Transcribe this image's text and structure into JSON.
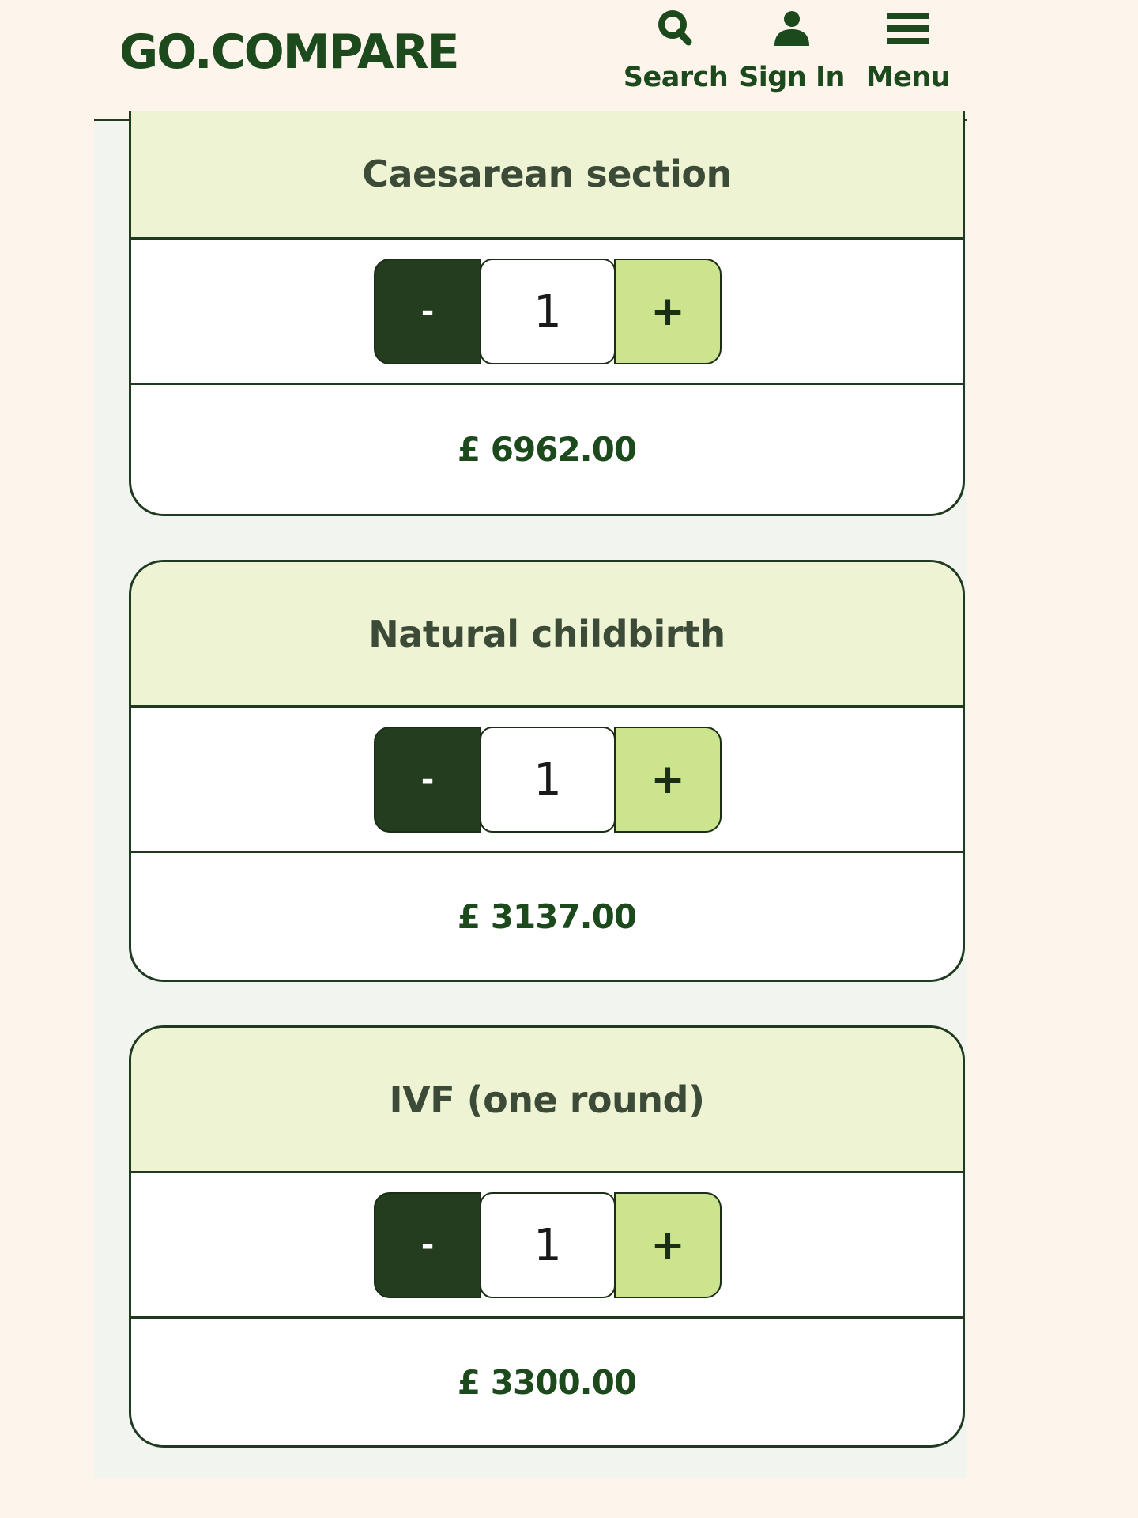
{
  "header": {
    "logo": "GO.COMPARE",
    "nav": [
      {
        "label": "Search",
        "icon": "search-icon"
      },
      {
        "label": "Sign In",
        "icon": "user-icon"
      },
      {
        "label": "Menu",
        "icon": "hamburger-menu-icon"
      }
    ]
  },
  "colors": {
    "brand_green": "#1d4a1d",
    "page_background": "#fdf5ec",
    "card_header": "#edf3d3",
    "minus_button": "#233d1e",
    "plus_button": "#cde48f"
  },
  "procedures": [
    {
      "title": "Caesarean section",
      "minus_label": "-",
      "quantity": "1",
      "plus_label": "+",
      "price": "£ 6962.00"
    },
    {
      "title": "Natural childbirth",
      "minus_label": "-",
      "quantity": "1",
      "plus_label": "+",
      "price": "£ 3137.00"
    },
    {
      "title": "IVF (one round)",
      "minus_label": "-",
      "quantity": "1",
      "plus_label": "+",
      "price": "£ 3300.00"
    }
  ]
}
